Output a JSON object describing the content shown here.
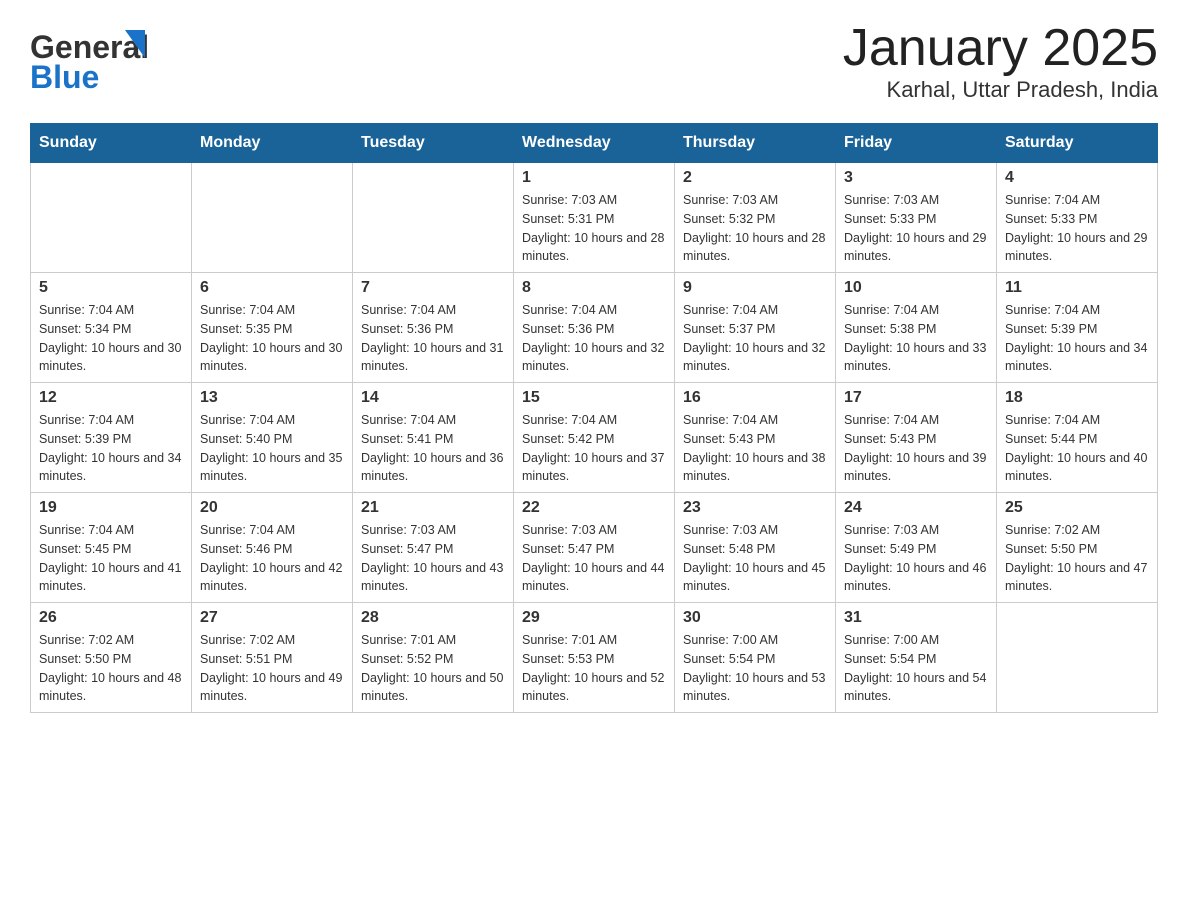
{
  "header": {
    "logo_general": "General",
    "logo_blue": "Blue",
    "month": "January 2025",
    "location": "Karhal, Uttar Pradesh, India"
  },
  "days_of_week": [
    "Sunday",
    "Monday",
    "Tuesday",
    "Wednesday",
    "Thursday",
    "Friday",
    "Saturday"
  ],
  "weeks": [
    [
      {
        "day": "",
        "sunrise": "",
        "sunset": "",
        "daylight": ""
      },
      {
        "day": "",
        "sunrise": "",
        "sunset": "",
        "daylight": ""
      },
      {
        "day": "",
        "sunrise": "",
        "sunset": "",
        "daylight": ""
      },
      {
        "day": "1",
        "sunrise": "Sunrise: 7:03 AM",
        "sunset": "Sunset: 5:31 PM",
        "daylight": "Daylight: 10 hours and 28 minutes."
      },
      {
        "day": "2",
        "sunrise": "Sunrise: 7:03 AM",
        "sunset": "Sunset: 5:32 PM",
        "daylight": "Daylight: 10 hours and 28 minutes."
      },
      {
        "day": "3",
        "sunrise": "Sunrise: 7:03 AM",
        "sunset": "Sunset: 5:33 PM",
        "daylight": "Daylight: 10 hours and 29 minutes."
      },
      {
        "day": "4",
        "sunrise": "Sunrise: 7:04 AM",
        "sunset": "Sunset: 5:33 PM",
        "daylight": "Daylight: 10 hours and 29 minutes."
      }
    ],
    [
      {
        "day": "5",
        "sunrise": "Sunrise: 7:04 AM",
        "sunset": "Sunset: 5:34 PM",
        "daylight": "Daylight: 10 hours and 30 minutes."
      },
      {
        "day": "6",
        "sunrise": "Sunrise: 7:04 AM",
        "sunset": "Sunset: 5:35 PM",
        "daylight": "Daylight: 10 hours and 30 minutes."
      },
      {
        "day": "7",
        "sunrise": "Sunrise: 7:04 AM",
        "sunset": "Sunset: 5:36 PM",
        "daylight": "Daylight: 10 hours and 31 minutes."
      },
      {
        "day": "8",
        "sunrise": "Sunrise: 7:04 AM",
        "sunset": "Sunset: 5:36 PM",
        "daylight": "Daylight: 10 hours and 32 minutes."
      },
      {
        "day": "9",
        "sunrise": "Sunrise: 7:04 AM",
        "sunset": "Sunset: 5:37 PM",
        "daylight": "Daylight: 10 hours and 32 minutes."
      },
      {
        "day": "10",
        "sunrise": "Sunrise: 7:04 AM",
        "sunset": "Sunset: 5:38 PM",
        "daylight": "Daylight: 10 hours and 33 minutes."
      },
      {
        "day": "11",
        "sunrise": "Sunrise: 7:04 AM",
        "sunset": "Sunset: 5:39 PM",
        "daylight": "Daylight: 10 hours and 34 minutes."
      }
    ],
    [
      {
        "day": "12",
        "sunrise": "Sunrise: 7:04 AM",
        "sunset": "Sunset: 5:39 PM",
        "daylight": "Daylight: 10 hours and 34 minutes."
      },
      {
        "day": "13",
        "sunrise": "Sunrise: 7:04 AM",
        "sunset": "Sunset: 5:40 PM",
        "daylight": "Daylight: 10 hours and 35 minutes."
      },
      {
        "day": "14",
        "sunrise": "Sunrise: 7:04 AM",
        "sunset": "Sunset: 5:41 PM",
        "daylight": "Daylight: 10 hours and 36 minutes."
      },
      {
        "day": "15",
        "sunrise": "Sunrise: 7:04 AM",
        "sunset": "Sunset: 5:42 PM",
        "daylight": "Daylight: 10 hours and 37 minutes."
      },
      {
        "day": "16",
        "sunrise": "Sunrise: 7:04 AM",
        "sunset": "Sunset: 5:43 PM",
        "daylight": "Daylight: 10 hours and 38 minutes."
      },
      {
        "day": "17",
        "sunrise": "Sunrise: 7:04 AM",
        "sunset": "Sunset: 5:43 PM",
        "daylight": "Daylight: 10 hours and 39 minutes."
      },
      {
        "day": "18",
        "sunrise": "Sunrise: 7:04 AM",
        "sunset": "Sunset: 5:44 PM",
        "daylight": "Daylight: 10 hours and 40 minutes."
      }
    ],
    [
      {
        "day": "19",
        "sunrise": "Sunrise: 7:04 AM",
        "sunset": "Sunset: 5:45 PM",
        "daylight": "Daylight: 10 hours and 41 minutes."
      },
      {
        "day": "20",
        "sunrise": "Sunrise: 7:04 AM",
        "sunset": "Sunset: 5:46 PM",
        "daylight": "Daylight: 10 hours and 42 minutes."
      },
      {
        "day": "21",
        "sunrise": "Sunrise: 7:03 AM",
        "sunset": "Sunset: 5:47 PM",
        "daylight": "Daylight: 10 hours and 43 minutes."
      },
      {
        "day": "22",
        "sunrise": "Sunrise: 7:03 AM",
        "sunset": "Sunset: 5:47 PM",
        "daylight": "Daylight: 10 hours and 44 minutes."
      },
      {
        "day": "23",
        "sunrise": "Sunrise: 7:03 AM",
        "sunset": "Sunset: 5:48 PM",
        "daylight": "Daylight: 10 hours and 45 minutes."
      },
      {
        "day": "24",
        "sunrise": "Sunrise: 7:03 AM",
        "sunset": "Sunset: 5:49 PM",
        "daylight": "Daylight: 10 hours and 46 minutes."
      },
      {
        "day": "25",
        "sunrise": "Sunrise: 7:02 AM",
        "sunset": "Sunset: 5:50 PM",
        "daylight": "Daylight: 10 hours and 47 minutes."
      }
    ],
    [
      {
        "day": "26",
        "sunrise": "Sunrise: 7:02 AM",
        "sunset": "Sunset: 5:50 PM",
        "daylight": "Daylight: 10 hours and 48 minutes."
      },
      {
        "day": "27",
        "sunrise": "Sunrise: 7:02 AM",
        "sunset": "Sunset: 5:51 PM",
        "daylight": "Daylight: 10 hours and 49 minutes."
      },
      {
        "day": "28",
        "sunrise": "Sunrise: 7:01 AM",
        "sunset": "Sunset: 5:52 PM",
        "daylight": "Daylight: 10 hours and 50 minutes."
      },
      {
        "day": "29",
        "sunrise": "Sunrise: 7:01 AM",
        "sunset": "Sunset: 5:53 PM",
        "daylight": "Daylight: 10 hours and 52 minutes."
      },
      {
        "day": "30",
        "sunrise": "Sunrise: 7:00 AM",
        "sunset": "Sunset: 5:54 PM",
        "daylight": "Daylight: 10 hours and 53 minutes."
      },
      {
        "day": "31",
        "sunrise": "Sunrise: 7:00 AM",
        "sunset": "Sunset: 5:54 PM",
        "daylight": "Daylight: 10 hours and 54 minutes."
      },
      {
        "day": "",
        "sunrise": "",
        "sunset": "",
        "daylight": ""
      }
    ]
  ],
  "colors": {
    "header_bg": "#1a6399",
    "header_text": "#ffffff",
    "border": "#cccccc"
  }
}
